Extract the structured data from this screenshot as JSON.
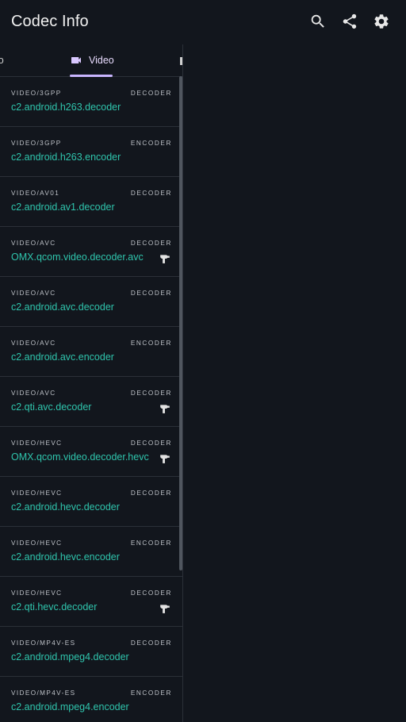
{
  "appbar": {
    "title": "Codec Info",
    "actions": [
      {
        "name": "search-icon"
      },
      {
        "name": "share-icon"
      },
      {
        "name": "settings-icon"
      }
    ]
  },
  "tabs": {
    "audio_partial": "io",
    "video": "Video",
    "selected": "Video"
  },
  "codecs": [
    {
      "mime": "VIDEO/3GPP",
      "kind": "DECODER",
      "name": "c2.android.h263.decoder",
      "hw": false
    },
    {
      "mime": "VIDEO/3GPP",
      "kind": "ENCODER",
      "name": "c2.android.h263.encoder",
      "hw": false
    },
    {
      "mime": "VIDEO/AV01",
      "kind": "DECODER",
      "name": "c2.android.av1.decoder",
      "hw": false
    },
    {
      "mime": "VIDEO/AVC",
      "kind": "DECODER",
      "name": "OMX.qcom.video.decoder.avc",
      "hw": true
    },
    {
      "mime": "VIDEO/AVC",
      "kind": "DECODER",
      "name": "c2.android.avc.decoder",
      "hw": false
    },
    {
      "mime": "VIDEO/AVC",
      "kind": "ENCODER",
      "name": "c2.android.avc.encoder",
      "hw": false
    },
    {
      "mime": "VIDEO/AVC",
      "kind": "DECODER",
      "name": "c2.qti.avc.decoder",
      "hw": true
    },
    {
      "mime": "VIDEO/HEVC",
      "kind": "DECODER",
      "name": "OMX.qcom.video.decoder.hevc",
      "hw": true
    },
    {
      "mime": "VIDEO/HEVC",
      "kind": "DECODER",
      "name": "c2.android.hevc.decoder",
      "hw": false
    },
    {
      "mime": "VIDEO/HEVC",
      "kind": "ENCODER",
      "name": "c2.android.hevc.encoder",
      "hw": false
    },
    {
      "mime": "VIDEO/HEVC",
      "kind": "DECODER",
      "name": "c2.qti.hevc.decoder",
      "hw": true
    },
    {
      "mime": "VIDEO/MP4V-ES",
      "kind": "DECODER",
      "name": "c2.android.mpeg4.decoder",
      "hw": false
    },
    {
      "mime": "VIDEO/MP4V-ES",
      "kind": "ENCODER",
      "name": "c2.android.mpeg4.encoder",
      "hw": false
    }
  ],
  "colors": {
    "background": "#12161d",
    "accent": "#c9b6ff",
    "codec_name": "#2fc5ad"
  }
}
